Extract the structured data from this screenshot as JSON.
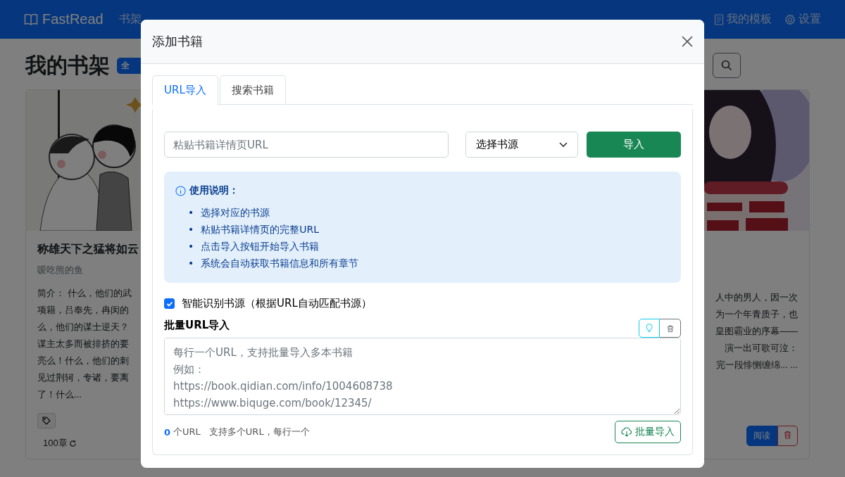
{
  "navbar": {
    "brand": "FastRead",
    "links": [
      "书架"
    ],
    "right_links": [
      {
        "label": "我的模板",
        "kind": "document"
      },
      {
        "label": "设置",
        "kind": "gear"
      }
    ]
  },
  "page": {
    "title": "我的书架",
    "badge": "全"
  },
  "books": [
    {
      "title": "称雄天下之猛将如云",
      "author": "嗳吃熊的鱼",
      "intro_lines": [
        "简介： 什么，他们的武",
        "项籍，吕奉先，冉闵的",
        "么，他们的谋士逆天？",
        "谋主太多而被排挤的要",
        "亮么！什么，他们的刺",
        "见过荆轲，专诸，要离",
        "了！什么..."
      ],
      "chapters": "100章"
    },
    {
      "intro_lines": [
        "人中的男人，因一次",
        "为一个年青质子，也",
        "皇图霸业的序幕——",
        "演一出可歌可泣：",
        "完一段悱恻缠绵... ..."
      ],
      "read_button": "阅读"
    }
  ],
  "modal": {
    "title": "添加书籍",
    "tabs": [
      {
        "label": "URL导入",
        "selected": true
      },
      {
        "label": "搜索书籍",
        "selected": false
      }
    ],
    "url_field": {
      "placeholder": "粘贴书籍详情页URL"
    },
    "source_select": {
      "value": "选择书源"
    },
    "import_button": "导入",
    "instructions": {
      "heading": "使用说明：",
      "marker": "•",
      "items": [
        "选择对应的书源",
        "粘贴书籍详情页的完整URL",
        "点击导入按钮开始导入书籍",
        "系统会自动获取书籍信息和所有章节"
      ]
    },
    "auto_detect": {
      "label": "智能识别书源（根据URL自动匹配书源）",
      "checked": true
    },
    "batch": {
      "label": "批量URL导入",
      "placeholder_lines": [
        "每行一个URL，支持批量导入多本书籍",
        "例如：",
        "https://book.qidian.com/info/1004608738",
        "https://www.biquge.com/book/12345/"
      ],
      "count": "0",
      "count_label": "个URL",
      "hint": "支持多个URL，每行一个",
      "button": "批量导入"
    }
  }
}
